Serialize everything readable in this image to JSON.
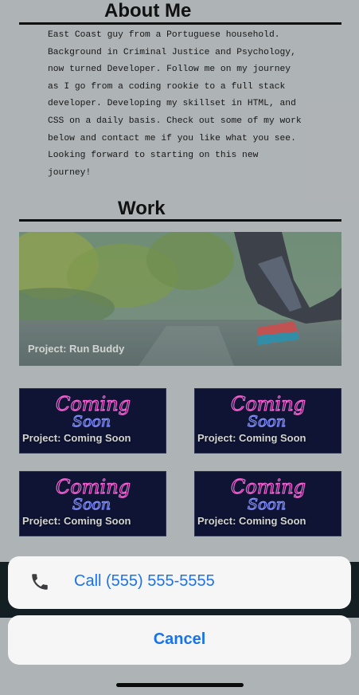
{
  "about": {
    "title": "About Me",
    "body": "   East Coast guy from a Portuguese household.\nBackground in Criminal Justice and Psychology,\nnow turned Developer. Follow me on my journey\nas I go from a coding rookie to a full stack\ndeveloper. Developing my skillset in HTML, and\nCSS on a daily basis. Check out some of my work\nbelow and contact me if you like what you see.\nLooking forward to starting on this new\njourney!"
  },
  "work": {
    "title": "Work",
    "featured": {
      "label": "Project: Run Buddy"
    },
    "projects": [
      {
        "label": "Project: Coming Soon",
        "art_text": [
          "Coming",
          "Soon"
        ]
      },
      {
        "label": "Project: Coming Soon",
        "art_text": [
          "Coming",
          "Soon"
        ]
      },
      {
        "label": "Project: Coming Soon",
        "art_text": [
          "Coming",
          "Soon"
        ]
      },
      {
        "label": "Project: Coming Soon",
        "art_text": [
          "Coming",
          "Soon"
        ]
      }
    ]
  },
  "action_sheet": {
    "call_label": "Call (555) 555-5555",
    "call_icon": "phone-icon",
    "cancel_label": "Cancel",
    "accent": "#1a73e8"
  }
}
